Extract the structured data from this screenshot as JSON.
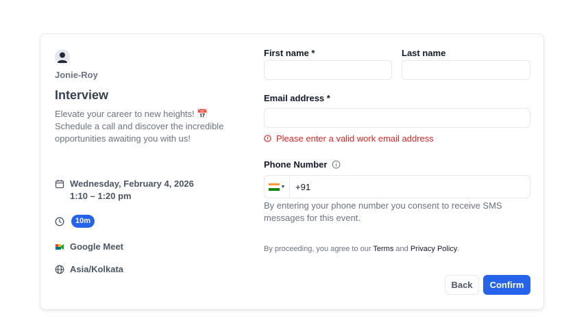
{
  "host": {
    "name": "Jonie-Roy"
  },
  "event": {
    "title": "Interview",
    "description": "Elevate your career to new heights! 📅 Schedule a call and discover the incredible opportunities awaiting you with us!",
    "date_line": "Wednesday, February 4, 2026",
    "time_line": "1:10 – 1:20 pm",
    "duration": "10m",
    "location": "Google Meet",
    "timezone": "Asia/Kolkata"
  },
  "form": {
    "first_name_label": "First name *",
    "last_name_label": "Last name",
    "email_label": "Email address *",
    "email_error": "Please enter a valid work email address",
    "phone_label": "Phone Number",
    "phone_value": "+91",
    "phone_consent": "By entering your phone number you consent to receive SMS messages for this event.",
    "terms_prefix": "By proceeding, you agree to our ",
    "terms_link": "Terms",
    "terms_and": " and ",
    "privacy_link": "Privacy Policy",
    "terms_suffix": "."
  },
  "actions": {
    "back_label": "Back",
    "confirm_label": "Confirm"
  },
  "colors": {
    "accent": "#2563eb",
    "error": "#dc2626",
    "muted_text": "#6b7280"
  },
  "icons": {
    "avatar": "avatar-icon",
    "calendar": "calendar-icon",
    "clock": "clock-icon",
    "meet": "google-meet-icon",
    "globe": "globe-icon",
    "error": "error-circle-icon",
    "info": "info-icon",
    "flag": "india-flag-icon"
  }
}
